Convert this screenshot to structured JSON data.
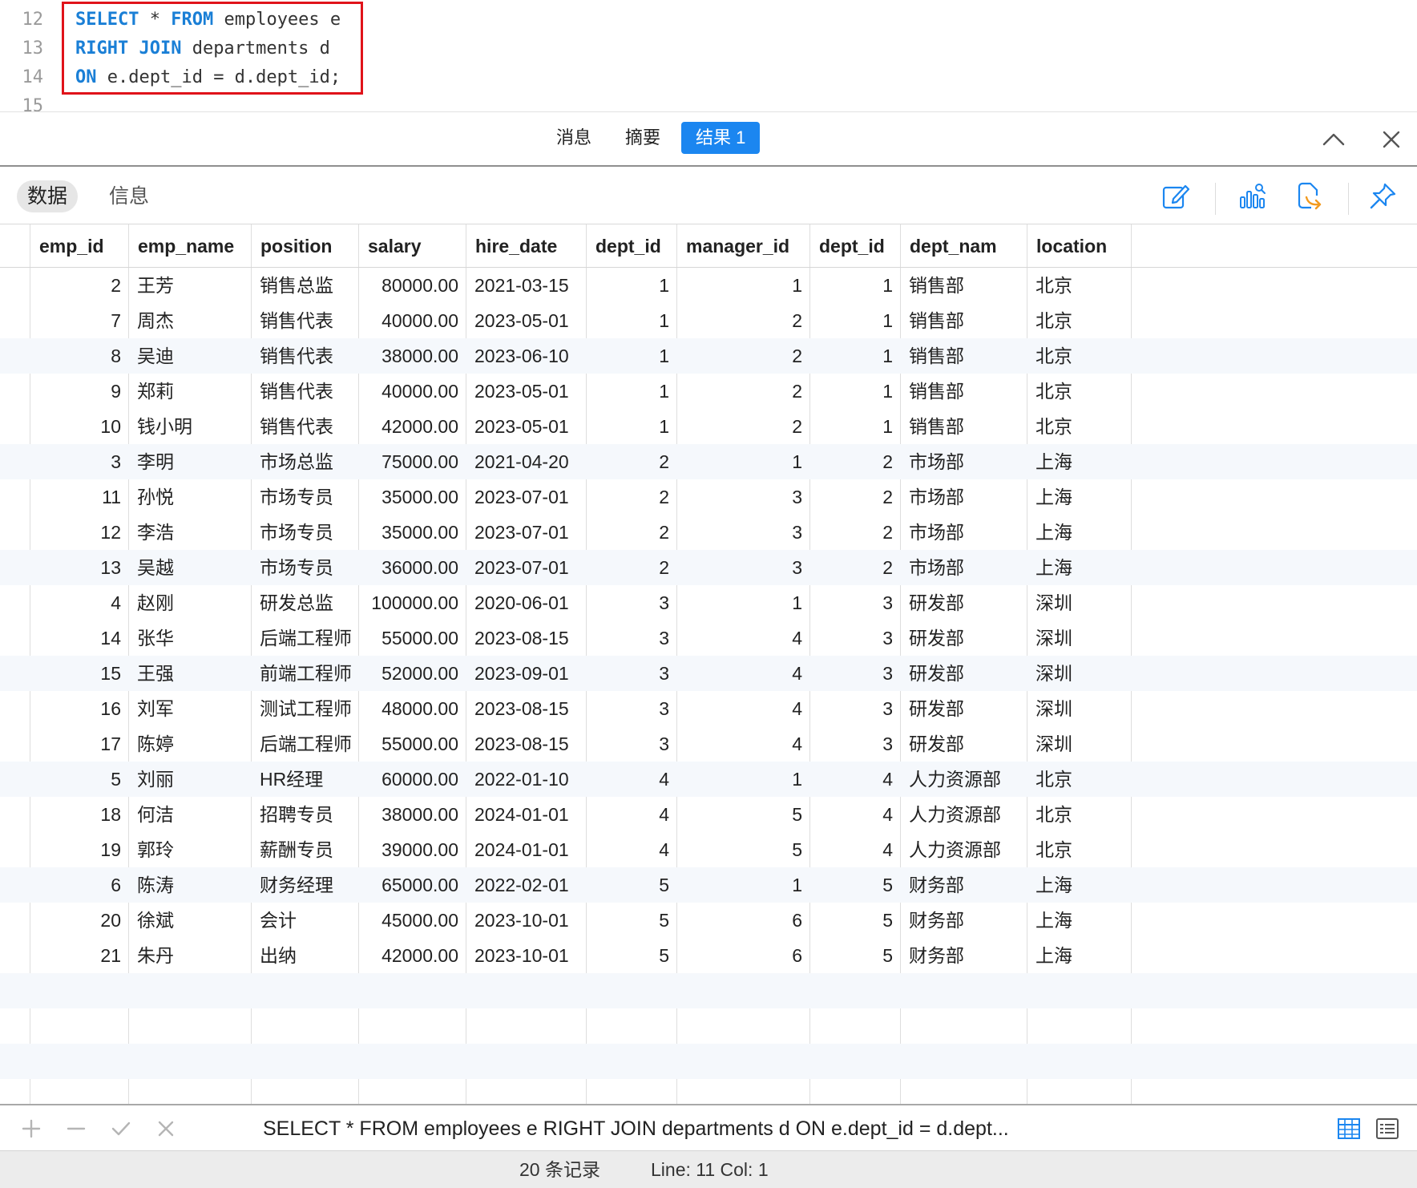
{
  "editor": {
    "lines": [
      {
        "no": "12",
        "tokens": [
          {
            "t": "SELECT",
            "kw": true
          },
          {
            "t": " * ",
            "kw": false
          },
          {
            "t": "FROM",
            "kw": true
          },
          {
            "t": " employees e",
            "kw": false
          }
        ]
      },
      {
        "no": "13",
        "tokens": [
          {
            "t": "RIGHT JOIN",
            "kw": true
          },
          {
            "t": " departments d",
            "kw": false
          }
        ]
      },
      {
        "no": "14",
        "tokens": [
          {
            "t": "ON",
            "kw": true
          },
          {
            "t": " e.dept_id = d.dept_id;",
            "kw": false
          }
        ]
      },
      {
        "no": "15",
        "tokens": []
      }
    ]
  },
  "tabs": {
    "items": [
      {
        "label": "消息",
        "active": false
      },
      {
        "label": "摘要",
        "active": false
      },
      {
        "label": "结果 1",
        "active": true
      }
    ]
  },
  "subbar": {
    "segments": [
      {
        "label": "数据",
        "active": true
      },
      {
        "label": "信息",
        "active": false
      }
    ],
    "tools": [
      "edit-icon",
      "chart-search-icon",
      "export-icon",
      "pin-icon"
    ]
  },
  "grid": {
    "columns": [
      "emp_id",
      "emp_name",
      "position",
      "salary",
      "hire_date",
      "dept_id",
      "manager_id",
      "dept_id",
      "dept_nam",
      "location"
    ],
    "rows": [
      [
        "2",
        "王芳",
        "销售总监",
        "80000.00",
        "2021-03-15",
        "1",
        "1",
        "1",
        "销售部",
        "北京"
      ],
      [
        "7",
        "周杰",
        "销售代表",
        "40000.00",
        "2023-05-01",
        "1",
        "2",
        "1",
        "销售部",
        "北京"
      ],
      [
        "8",
        "吴迪",
        "销售代表",
        "38000.00",
        "2023-06-10",
        "1",
        "2",
        "1",
        "销售部",
        "北京"
      ],
      [
        "9",
        "郑莉",
        "销售代表",
        "40000.00",
        "2023-05-01",
        "1",
        "2",
        "1",
        "销售部",
        "北京"
      ],
      [
        "10",
        "钱小明",
        "销售代表",
        "42000.00",
        "2023-05-01",
        "1",
        "2",
        "1",
        "销售部",
        "北京"
      ],
      [
        "3",
        "李明",
        "市场总监",
        "75000.00",
        "2021-04-20",
        "2",
        "1",
        "2",
        "市场部",
        "上海"
      ],
      [
        "11",
        "孙悦",
        "市场专员",
        "35000.00",
        "2023-07-01",
        "2",
        "3",
        "2",
        "市场部",
        "上海"
      ],
      [
        "12",
        "李浩",
        "市场专员",
        "35000.00",
        "2023-07-01",
        "2",
        "3",
        "2",
        "市场部",
        "上海"
      ],
      [
        "13",
        "吴越",
        "市场专员",
        "36000.00",
        "2023-07-01",
        "2",
        "3",
        "2",
        "市场部",
        "上海"
      ],
      [
        "4",
        "赵刚",
        "研发总监",
        "100000.00",
        "2020-06-01",
        "3",
        "1",
        "3",
        "研发部",
        "深圳"
      ],
      [
        "14",
        "张华",
        "后端工程师",
        "55000.00",
        "2023-08-15",
        "3",
        "4",
        "3",
        "研发部",
        "深圳"
      ],
      [
        "15",
        "王强",
        "前端工程师",
        "52000.00",
        "2023-09-01",
        "3",
        "4",
        "3",
        "研发部",
        "深圳"
      ],
      [
        "16",
        "刘军",
        "测试工程师",
        "48000.00",
        "2023-08-15",
        "3",
        "4",
        "3",
        "研发部",
        "深圳"
      ],
      [
        "17",
        "陈婷",
        "后端工程师",
        "55000.00",
        "2023-08-15",
        "3",
        "4",
        "3",
        "研发部",
        "深圳"
      ],
      [
        "5",
        "刘丽",
        "HR经理",
        "60000.00",
        "2022-01-10",
        "4",
        "1",
        "4",
        "人力资源部",
        "北京"
      ],
      [
        "18",
        "何洁",
        "招聘专员",
        "38000.00",
        "2024-01-01",
        "4",
        "5",
        "4",
        "人力资源部",
        "北京"
      ],
      [
        "19",
        "郭玲",
        "薪酬专员",
        "39000.00",
        "2024-01-01",
        "4",
        "5",
        "4",
        "人力资源部",
        "北京"
      ],
      [
        "6",
        "陈涛",
        "财务经理",
        "65000.00",
        "2022-02-01",
        "5",
        "1",
        "5",
        "财务部",
        "上海"
      ],
      [
        "20",
        "徐斌",
        "会计",
        "45000.00",
        "2023-10-01",
        "5",
        "6",
        "5",
        "财务部",
        "上海"
      ],
      [
        "21",
        "朱丹",
        "出纳",
        "42000.00",
        "2023-10-01",
        "5",
        "6",
        "5",
        "财务部",
        "上海"
      ]
    ]
  },
  "bottombar": {
    "sql_preview": "SELECT * FROM employees e RIGHT JOIN departments d ON e.dept_id = d.dept..."
  },
  "status": {
    "record_count": "20 条记录",
    "cursor": "Line: 11  Col: 1"
  },
  "colors": {
    "accent": "#1b86f0",
    "keyword": "#1a7fd6",
    "highlight_border": "#e0131a",
    "alt_row": "#f5f8fc"
  }
}
